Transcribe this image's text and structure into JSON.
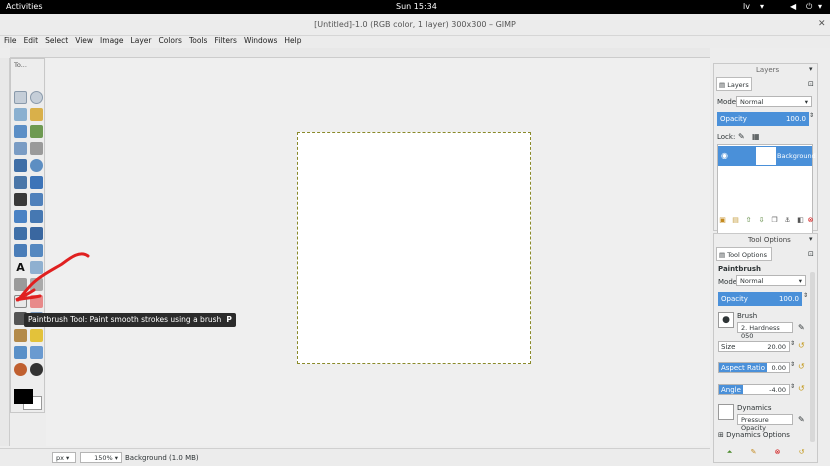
{
  "topbar": {
    "activities": "Activities",
    "clock": "Sun 15:34",
    "lang": "lv"
  },
  "window": {
    "title": "[Untitled]-1.0 (RGB color, 1 layer) 300x300 – GIMP"
  },
  "menu": [
    "File",
    "Edit",
    "Select",
    "View",
    "Image",
    "Layer",
    "Colors",
    "Tools",
    "Filters",
    "Windows",
    "Help"
  ],
  "toolbox": {
    "title": "To..."
  },
  "tooltip": {
    "text": "Paintbrush Tool: Paint smooth strokes using a brush",
    "shortcut": "P"
  },
  "status": {
    "unit": "px",
    "zoom": "150%",
    "info": "Background (1.0 MB)"
  },
  "layers": {
    "dock_title": "Layers",
    "tab": "Layers",
    "mode_label": "Mode",
    "mode_value": "Normal",
    "opacity_label": "Opacity",
    "opacity_value": "100.0",
    "lock_label": "Lock:",
    "layer_name": "Background"
  },
  "tool_options": {
    "dock_title": "Tool Options",
    "tab": "Tool Options",
    "tool_name": "Paintbrush",
    "mode_label": "Mode:",
    "mode_value": "Normal",
    "opacity_label": "Opacity",
    "opacity_value": "100.0",
    "brush_label": "Brush",
    "brush_value": "2. Hardness 050",
    "size_label": "Size",
    "size_value": "20.00",
    "aspect_label": "Aspect Ratio",
    "aspect_value": "0.00",
    "angle_label": "Angle",
    "angle_value": "-4.00",
    "dynamics_label": "Dynamics",
    "dynamics_value": "Pressure Opacity",
    "dynamics_options": "Dynamics Options"
  },
  "colors": {
    "fg": "#000000",
    "bg": "#ffffff",
    "accent": "#4a90d9",
    "annotation": "#e02020"
  }
}
